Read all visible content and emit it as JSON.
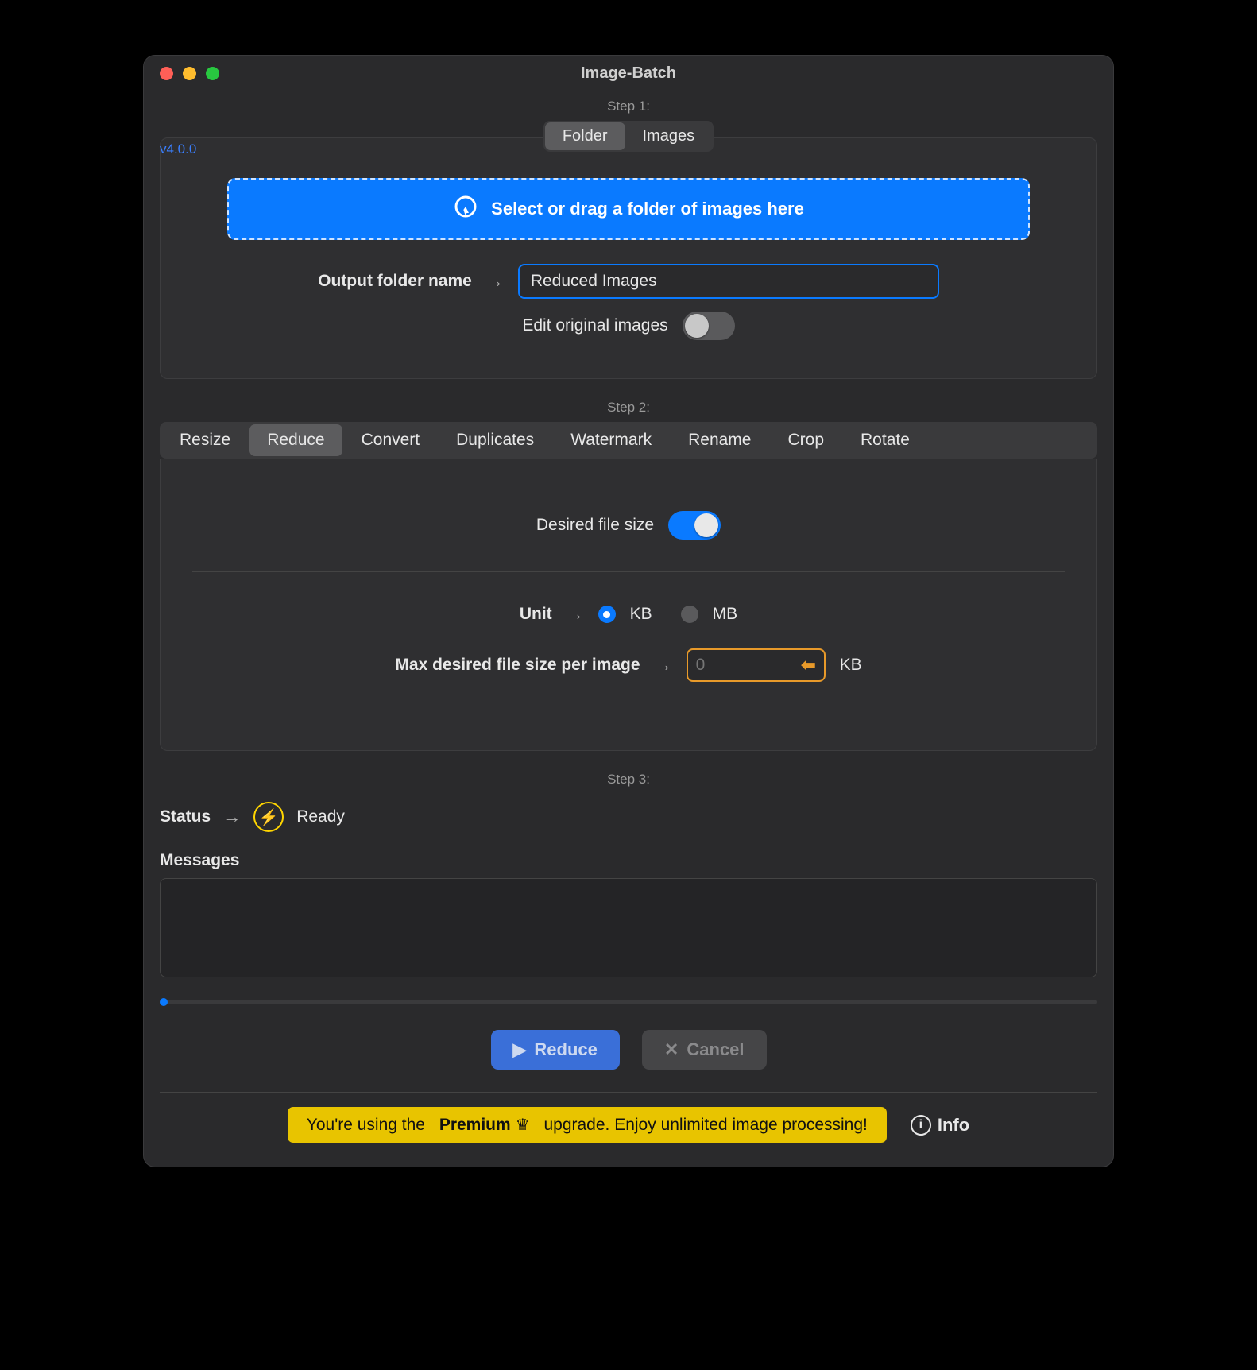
{
  "app": {
    "title": "Image-Batch",
    "version": "v4.0.0"
  },
  "steps": {
    "step1_label": "Step 1:",
    "step2_label": "Step 2:",
    "step3_label": "Step 3:"
  },
  "source_mode": {
    "options": [
      "Folder",
      "Images"
    ],
    "selected": "Folder"
  },
  "dropzone": {
    "text": "Select or drag a folder of images here"
  },
  "output": {
    "label": "Output folder name",
    "value": "Reduced Images"
  },
  "edit_original": {
    "label": "Edit original images",
    "enabled": false
  },
  "operation_tabs": {
    "items": [
      "Resize",
      "Reduce",
      "Convert",
      "Duplicates",
      "Watermark",
      "Rename",
      "Crop",
      "Rotate"
    ],
    "selected": "Reduce"
  },
  "reduce": {
    "desired_label": "Desired file size",
    "desired_enabled": true,
    "unit_label": "Unit",
    "units": [
      "KB",
      "MB"
    ],
    "unit_selected": "KB",
    "max_label": "Max desired file size per image",
    "max_placeholder": "0",
    "max_value": "",
    "max_suffix": "KB"
  },
  "status": {
    "label": "Status",
    "value": "Ready"
  },
  "messages": {
    "label": "Messages",
    "content": ""
  },
  "actions": {
    "primary": "Reduce",
    "cancel": "Cancel"
  },
  "footer": {
    "banner_prefix": "You're using the",
    "banner_premium": "Premium",
    "banner_suffix": "upgrade. Enjoy unlimited image processing!",
    "info": "Info"
  }
}
